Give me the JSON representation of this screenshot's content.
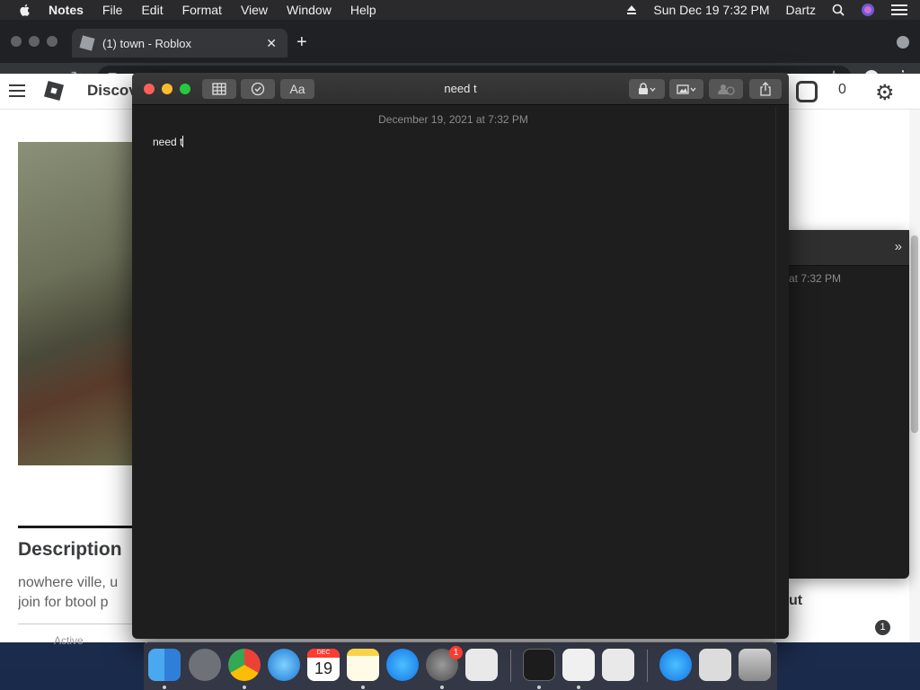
{
  "menubar": {
    "app_name": "Notes",
    "items": [
      "File",
      "Edit",
      "Format",
      "View",
      "Window",
      "Help"
    ],
    "clock": "Sun Dec 19  7:32 PM",
    "user": "Dartz"
  },
  "browser": {
    "tab_title": "(1) town - Roblox",
    "tab_close": "✕",
    "new_tab": "+"
  },
  "roblox": {
    "header_label": "Discov",
    "robux_count": "0",
    "description_title": "Description",
    "description_line1": "nowhere ville, u",
    "description_line2": "join for btool p",
    "stat_label": "Active",
    "right_fragment": "ut",
    "badge_count": "1"
  },
  "notes_window": {
    "title": "need t",
    "date": "December 19, 2021 at 7:32 PM",
    "body": "need t",
    "buttons": {
      "table": "table-icon",
      "checklist": "checklist-icon",
      "format": "Aa",
      "lock": "lock-icon",
      "media": "media-icon",
      "collaborate": "collaborate-icon",
      "share": "share-icon"
    }
  },
  "notes_window_back": {
    "time": "at 7:32 PM",
    "chevron": "»"
  },
  "dock": {
    "calendar_month": "DEC",
    "calendar_day": "19",
    "settings_badge": "1"
  },
  "colors": {
    "close": "#ff5f57",
    "minimize": "#febc2e",
    "maximize": "#28c840",
    "notes_bg": "#1e1e1e"
  }
}
